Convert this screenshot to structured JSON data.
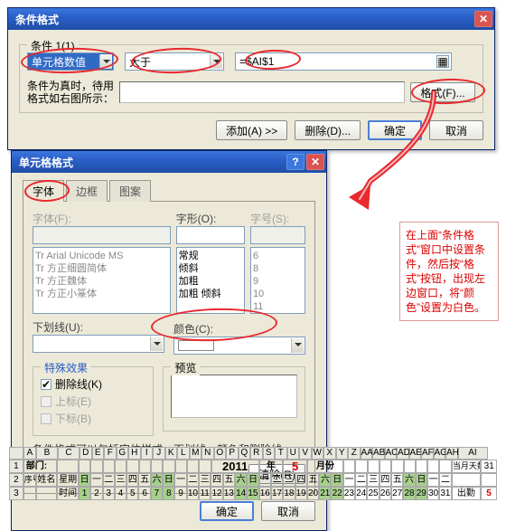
{
  "dialog1": {
    "title": "条件格式",
    "legend": "条件 1(1)",
    "select1": "单元格数值",
    "select2": "大于",
    "formula": "=$AI$1",
    "sample_label": "条件为真时，待用\n格式如右图所示：",
    "format_btn": "格式(F)...",
    "add_btn": "添加(A) >>",
    "del_btn": "删除(D)...",
    "ok": "确定",
    "cancel": "取消"
  },
  "dialog2": {
    "title": "单元格格式",
    "tab_font": "字体",
    "tab_border": "边框",
    "tab_pattern": "图案",
    "lbl_font": "字体(F):",
    "lbl_style": "字形(O):",
    "lbl_size": "字号(S):",
    "fonts": [
      "Tr Arial Unicode MS",
      "Tr 方正细圆简体",
      "Tr 方正魏体",
      "Tr 方正小篆体"
    ],
    "styles": [
      "常规",
      "倾斜",
      "加粗",
      "加粗 倾斜"
    ],
    "sizes": [
      "6",
      "8",
      "9",
      "10",
      "11"
    ],
    "lbl_under": "下划线(U):",
    "lbl_color": "颜色(C):",
    "grp_effects": "特殊效果",
    "cb_strike": "删除线(K)",
    "cb_super": "上标(E)",
    "cb_sub": "下标(B)",
    "grp_preview": "预览",
    "tip": "条件格式可以包括字体样式、下划线、颜色和删除线。",
    "clear": "清除(R)",
    "ok": "确定",
    "cancel": "取消"
  },
  "annotation": "在上面“条件格式”窗口中设置条件，然后按“格式”按钮，出现左边窗口，将“颜色”设置为白色。",
  "sheet": {
    "cols": [
      "A",
      "B",
      "C",
      "D",
      "E",
      "F",
      "G",
      "H",
      "I",
      "J",
      "K",
      "L",
      "M",
      "N",
      "O",
      "P",
      "Q",
      "R",
      "S",
      "T",
      "U",
      "V",
      "W",
      "X",
      "Y",
      "Z",
      "AA",
      "AB",
      "AC",
      "AD",
      "AE",
      "AF",
      "AG",
      "AH",
      "AI"
    ],
    "r1_label": "部门:",
    "r1_year": "2011",
    "r1_ylabel": "年",
    "r1_month": "5",
    "r1_mlabel": "月份",
    "r1_days_label": "当月天数:",
    "r1_days": "31",
    "r2_a": "序号",
    "r2_b": "姓名",
    "r2_c": "星期",
    "weekdays": [
      "日",
      "一",
      "二",
      "三",
      "四",
      "五",
      "六",
      "日",
      "一",
      "二",
      "三",
      "四",
      "五",
      "六",
      "日",
      "一",
      "二",
      "三",
      "四",
      "五",
      "六",
      "日",
      "一",
      "二",
      "三",
      "四",
      "五",
      "六",
      "日",
      "一",
      "二"
    ],
    "r3_c": "时间",
    "nums": [
      "1",
      "2",
      "3",
      "4",
      "5",
      "6",
      "7",
      "8",
      "9",
      "10",
      "11",
      "12",
      "13",
      "14",
      "15",
      "16",
      "17",
      "18",
      "19",
      "20",
      "21",
      "22",
      "23",
      "24",
      "25",
      "26",
      "27",
      "28",
      "29",
      "30",
      "31"
    ],
    "r3_ah": "出勤",
    "r3_ai": "5"
  }
}
